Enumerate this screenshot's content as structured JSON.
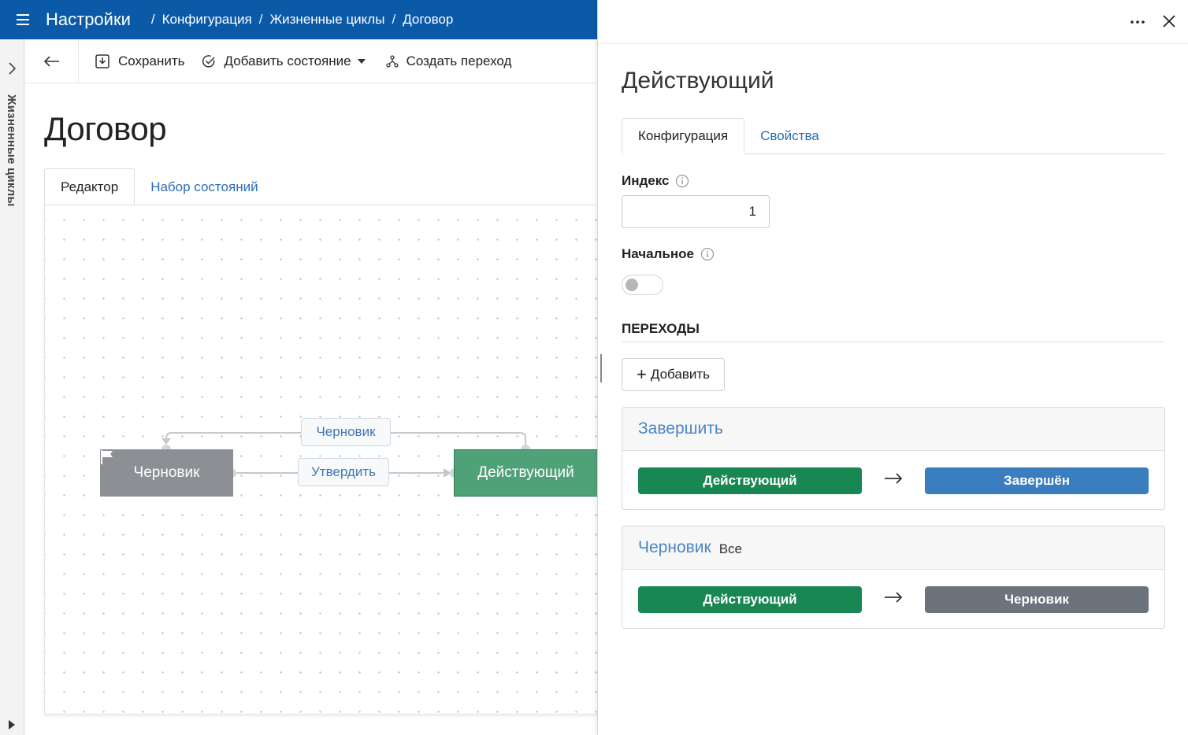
{
  "header": {
    "app_title": "Настройки",
    "breadcrumbs": [
      "Конфигурация",
      "Жизненные циклы",
      "Договор"
    ]
  },
  "rail": {
    "label": "Жизненные циклы"
  },
  "toolbar": {
    "save_label": "Сохранить",
    "add_state_label": "Добавить состояние",
    "create_transition_label": "Создать переход"
  },
  "page": {
    "title": "Договор",
    "tabs": [
      {
        "label": "Редактор",
        "active": true
      },
      {
        "label": "Набор состояний",
        "active": false
      }
    ]
  },
  "diagram": {
    "nodes": [
      {
        "id": "draft",
        "label": "Черновик",
        "color": "#8c9094",
        "icon": "flag-icon"
      },
      {
        "id": "active",
        "label": "Действующий",
        "color": "#4fa277"
      }
    ],
    "edges": [
      {
        "from": "active",
        "to": "draft",
        "label": "Черновик"
      },
      {
        "from": "draft",
        "to": "active",
        "label": "Утвердить"
      }
    ]
  },
  "panel": {
    "title": "Действующий",
    "tabs": [
      {
        "label": "Конфигурация",
        "active": true
      },
      {
        "label": "Свойства",
        "active": false
      }
    ],
    "index_label": "Индекс",
    "index_value": "1",
    "initial_label": "Начальное",
    "initial_value": false,
    "transitions_title": "ПЕРЕХОДЫ",
    "add_label": "Добавить",
    "transitions": [
      {
        "name": "Завершить",
        "scope": "",
        "from": "Действующий",
        "from_color": "#198754",
        "to": "Завершён",
        "to_color": "#3a7ec0"
      },
      {
        "name": "Черновик",
        "scope": "Все",
        "from": "Действующий",
        "from_color": "#198754",
        "to": "Черновик",
        "to_color": "#6c737c"
      }
    ]
  }
}
